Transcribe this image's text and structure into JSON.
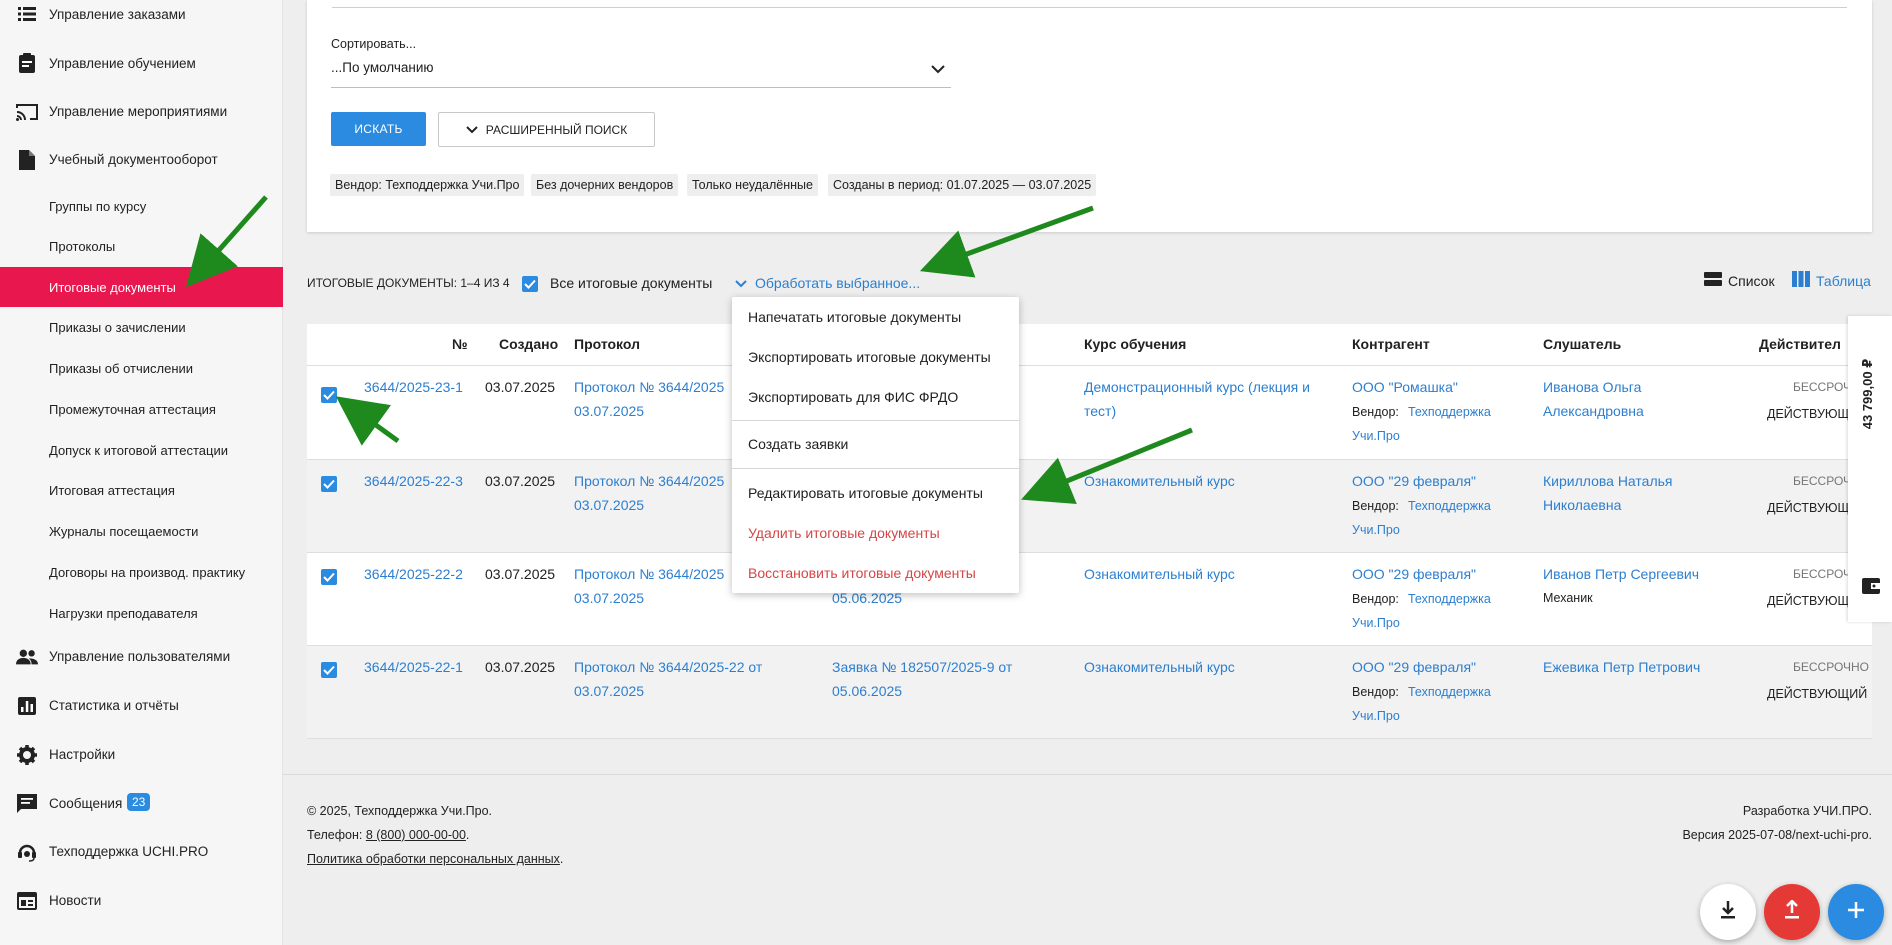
{
  "sidebar": {
    "items": [
      {
        "label": "Управление заказами",
        "icon": "list-icon"
      },
      {
        "label": "Управление обучением",
        "icon": "clipboard-icon"
      },
      {
        "label": "Управление мероприятиями",
        "icon": "cast-icon"
      },
      {
        "label": "Учебный документооборот",
        "icon": "document-icon"
      }
    ],
    "subitems": [
      "Группы по курсу",
      "Протоколы",
      "Итоговые документы",
      "Приказы о зачислении",
      "Приказы об отчислении",
      "Промежуточная аттестация",
      "Допуск к итоговой аттестации",
      "Итоговая аттестация",
      "Журналы посещаемости",
      "Договоры на производ. практику",
      "Нагрузки преподавателя"
    ],
    "bottom_items": [
      {
        "label": "Управление пользователями",
        "icon": "users-icon"
      },
      {
        "label": "Статистика и отчёты",
        "icon": "stats-icon"
      },
      {
        "label": "Настройки",
        "icon": "gear-icon"
      },
      {
        "label": "Сообщения",
        "icon": "message-icon",
        "badge": "23"
      },
      {
        "label": "Техподдержка UCHI.PRO",
        "icon": "support-icon"
      },
      {
        "label": "Новости",
        "icon": "news-icon"
      }
    ]
  },
  "filter": {
    "sort_label": "Сортировать...",
    "sort_value": "...По умолчанию",
    "search_button": "ИСКАТЬ",
    "advanced_button": "РАСШИРЕННЫЙ ПОИСК",
    "chips": [
      "Вендор: Техподдержка Учи.Про",
      "Без дочерних вендоров",
      "Только неудалённые",
      "Созданы в период: 01.07.2025 — 03.07.2025"
    ]
  },
  "results": {
    "count": "ИТОГОВЫЕ ДОКУМЕНТЫ: 1–4 ИЗ 4",
    "all_label": "Все итоговые документы",
    "process_label": "Обработать выбранное...",
    "view_list": "Список",
    "view_table": "Таблица"
  },
  "table": {
    "headers": [
      "№",
      "Создано",
      "Протокол",
      "Курс обучения",
      "Контрагент",
      "Слушатель",
      "Действител"
    ],
    "rows": [
      {
        "number": "3644/2025-23-1",
        "created": "03.07.2025",
        "protocol_1": "Протокол № 3644/2025",
        "protocol_2": "03.07.2025",
        "request_1": "",
        "request_2": "",
        "course_1": "Демонстрационный курс (лекция и",
        "course_2": "тест)",
        "contractor": "ООО \"Ромашка\"",
        "vendor_label": "Вендор:",
        "vendor_1": "Техподдержка",
        "vendor_2": "Учи.Про",
        "student_1": "Иванова Ольга",
        "student_2": "Александровна",
        "validity": "БЕССРОЧНО",
        "status": "ДЕЙСТВУЮЩИ"
      },
      {
        "number": "3644/2025-22-3",
        "created": "03.07.2025",
        "protocol_1": "Протокол № 3644/2025",
        "protocol_2": "03.07.2025",
        "request_1": "",
        "request_2": "",
        "course_1": "Ознакомительный курс",
        "course_2": "",
        "contractor": "ООО \"29 февраля\"",
        "vendor_label": "Вендор:",
        "vendor_1": "Техподдержка",
        "vendor_2": "Учи.Про",
        "student_1": "Кириллова Наталья",
        "student_2": "Николаевна",
        "validity": "БЕССРОЧНО",
        "status": "ДЕЙСТВУЮЩИ"
      },
      {
        "number": "3644/2025-22-2",
        "created": "03.07.2025",
        "protocol_1": "Протокол № 3644/2025",
        "protocol_2": "03.07.2025",
        "request_1": "",
        "request_2": "05.06.2025",
        "course_1": "Ознакомительный курс",
        "course_2": "",
        "contractor": "ООО \"29 февраля\"",
        "vendor_label": "Вендор:",
        "vendor_1": "Техподдержка",
        "vendor_2": "Учи.Про",
        "student_1": "Иванов Петр Сергеевич",
        "student_2": "Механик",
        "validity": "БЕССРОЧНО",
        "status": "ДЕЙСТВУЮЩИ"
      },
      {
        "number": "3644/2025-22-1",
        "created": "03.07.2025",
        "protocol_1": "Протокол № 3644/2025-22 от",
        "protocol_2": "03.07.2025",
        "request_1": "Заявка № 182507/2025-9 от",
        "request_2": "05.06.2025",
        "course_1": "Ознакомительный курс",
        "course_2": "",
        "contractor": "ООО \"29 февраля\"",
        "vendor_label": "Вендор:",
        "vendor_1": "Техподдержка",
        "vendor_2": "Учи.Про",
        "student_1": "Ежевика Петр Петрович",
        "student_2": "",
        "validity": "БЕССРОЧНО",
        "status": "ДЕЙСТВУЮЩИЙ"
      }
    ]
  },
  "menu": {
    "items": [
      "Напечатать итоговые документы",
      "Экспортировать итоговые документы",
      "Экспортировать для ФИС ФРДО",
      "Создать заявки",
      "Редактировать итоговые документы",
      "Удалить итоговые документы",
      "Восстановить итоговые документы"
    ]
  },
  "side_panel": {
    "balance": "43 799,00 ₽"
  },
  "footer": {
    "copyright": "©  2025, Техподдержка Учи.Про.",
    "phone_label": "Телефон:",
    "phone": "8 (800) 000-00-00",
    "policy": "Политика обработки персональных данных",
    "developer": "Разработка УЧИ.ПРО.",
    "version": "Версия 2025-07-08/next-uchi-pro."
  },
  "colors": {
    "accent": "#2a8be0",
    "active": "#e8184f",
    "danger": "#d64545",
    "arrow": "#1e8a1e"
  }
}
